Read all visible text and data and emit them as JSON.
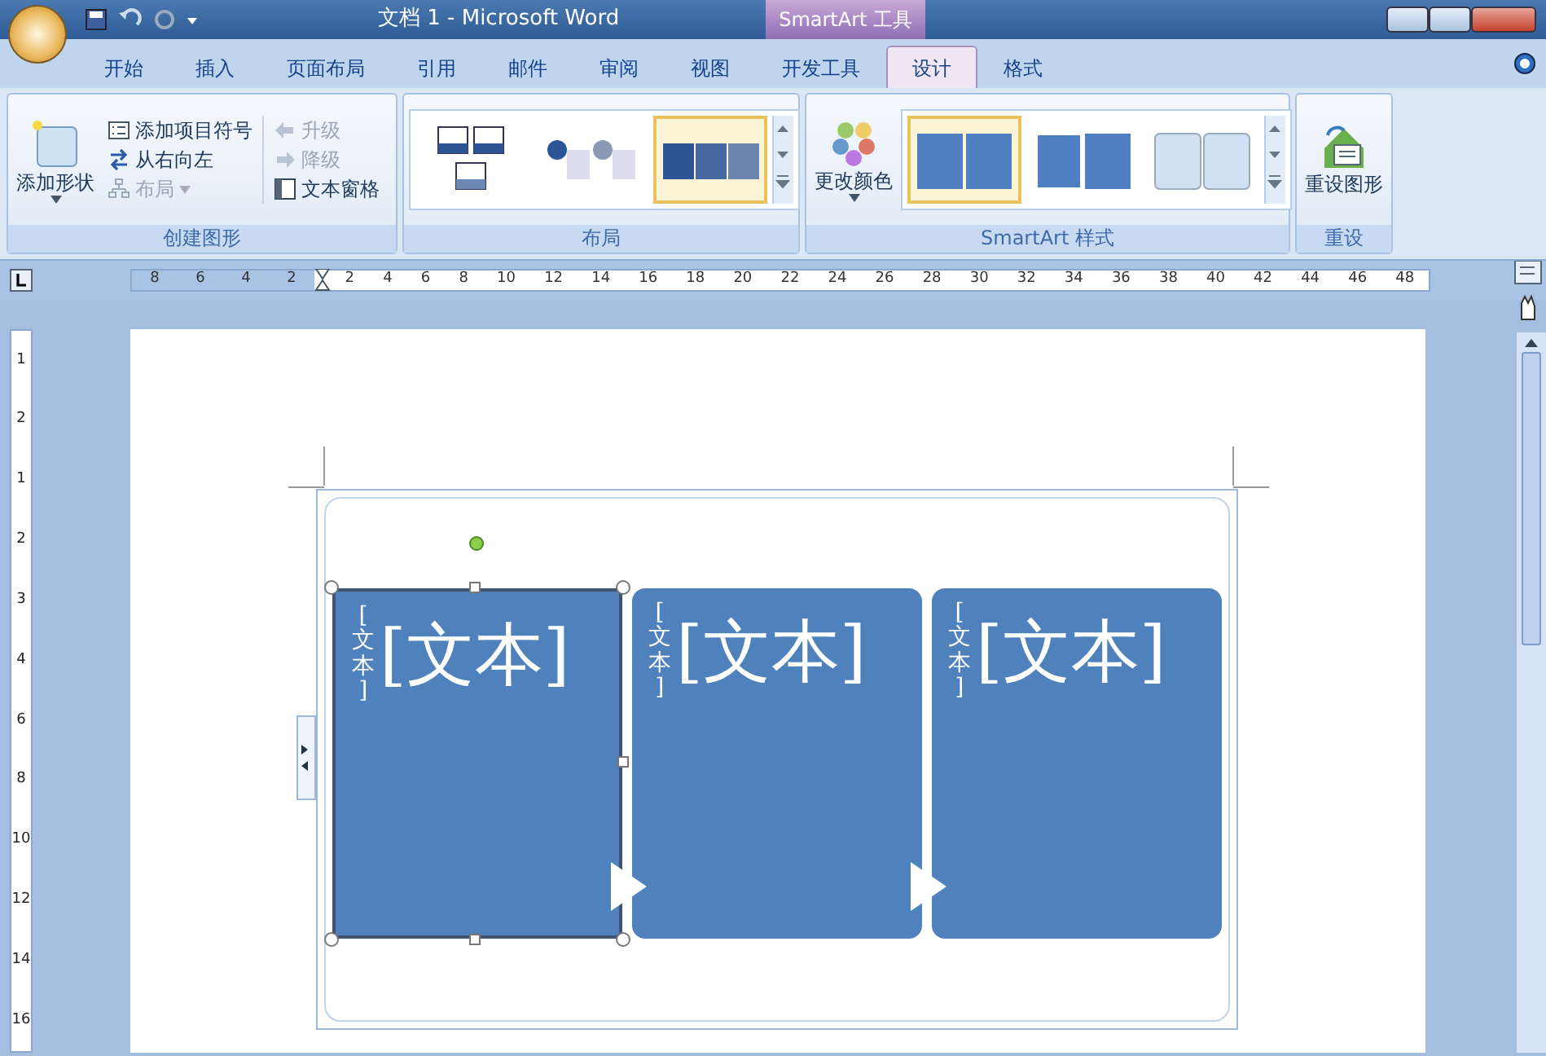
{
  "window": {
    "title": "文档 1 - Microsoft Word",
    "context_title": "SmartArt 工具"
  },
  "tabs": [
    {
      "label": "开始",
      "selected": false
    },
    {
      "label": "插入",
      "selected": false
    },
    {
      "label": "页面布局",
      "selected": false
    },
    {
      "label": "引用",
      "selected": false
    },
    {
      "label": "邮件",
      "selected": false
    },
    {
      "label": "审阅",
      "selected": false
    },
    {
      "label": "视图",
      "selected": false
    },
    {
      "label": "开发工具",
      "selected": false
    },
    {
      "label": "设计",
      "selected": true
    },
    {
      "label": "格式",
      "selected": false
    }
  ],
  "ribbon": {
    "create_group": {
      "label": "创建图形",
      "add_shape": {
        "label": "添加形状",
        "dropdown": true
      },
      "small_buttons": [
        {
          "label": "添加项目符号",
          "kind": "bullets",
          "disabled": false,
          "dropdown": false
        },
        {
          "label": "从右向左",
          "kind": "swap",
          "disabled": false,
          "dropdown": false
        },
        {
          "label": "布局",
          "kind": "org",
          "disabled": true,
          "dropdown": true
        },
        {
          "label": "升级",
          "kind": "left",
          "disabled": true,
          "dropdown": false
        },
        {
          "label": "降级",
          "kind": "right",
          "disabled": true,
          "dropdown": false
        },
        {
          "label": "文本窗格",
          "kind": "pane",
          "disabled": false,
          "dropdown": false
        }
      ]
    },
    "layout_group": {
      "label": "布局",
      "layouts": [
        {
          "kind": "grid",
          "selected": false
        },
        {
          "kind": "circles",
          "selected": false
        },
        {
          "kind": "row",
          "selected": true
        }
      ]
    },
    "style_group": {
      "label": "SmartArt 样式",
      "change_colors": "更改颜色",
      "styles": [
        {
          "kind": "flat",
          "selected": true
        },
        {
          "kind": "outlined",
          "selected": false
        },
        {
          "kind": "glossy",
          "selected": false
        }
      ]
    },
    "reset_group": {
      "label": "重设",
      "reset": "重设图形"
    }
  },
  "ruler": {
    "left_numbers": [
      "8",
      "6",
      "4",
      "2"
    ],
    "right_numbers": [
      "2",
      "4",
      "6",
      "8",
      "10",
      "12",
      "14",
      "16",
      "18",
      "20",
      "22",
      "24",
      "26",
      "28",
      "30",
      "32",
      "34",
      "36",
      "38",
      "40",
      "42",
      "44",
      "46",
      "48"
    ]
  },
  "vertical_ruler": {
    "numbers": [
      "1",
      "2",
      "1",
      "2",
      "3",
      "4",
      "6",
      "8",
      "10",
      "12",
      "14",
      "16"
    ]
  },
  "smartart": {
    "nodes": [
      {
        "text": "[文本]",
        "side_text": "[文本]",
        "selected": true
      },
      {
        "text": "[文本]",
        "side_text": "[文本]",
        "selected": false
      },
      {
        "text": "[文本]",
        "side_text": "[文本]",
        "selected": false
      }
    ]
  }
}
